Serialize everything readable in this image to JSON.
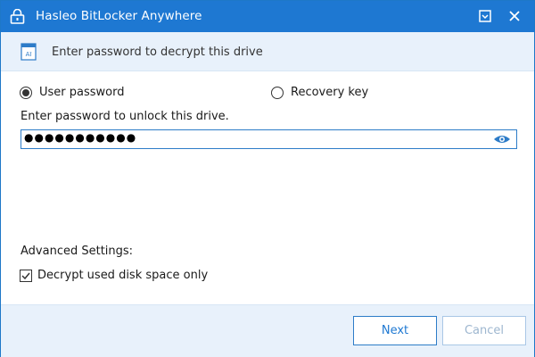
{
  "window": {
    "title": "Hasleo BitLocker Anywhere",
    "title_color": "#1e78d2"
  },
  "header": {
    "text": "Enter password to decrypt this drive",
    "background": "#e8f1fb"
  },
  "unlock_method": {
    "options": [
      {
        "label": "User password",
        "selected": true
      },
      {
        "label": "Recovery key",
        "selected": false
      }
    ]
  },
  "password": {
    "prompt": "Enter password to unlock this drive.",
    "masked_value": "●●●●●●●●●●●",
    "toggle_icon": "eye-icon"
  },
  "advanced": {
    "heading": "Advanced Settings:",
    "decrypt_used_only": {
      "label": "Decrypt used disk space only",
      "checked": true
    }
  },
  "footer": {
    "next_label": "Next",
    "cancel_label": "Cancel",
    "cancel_enabled": false
  }
}
